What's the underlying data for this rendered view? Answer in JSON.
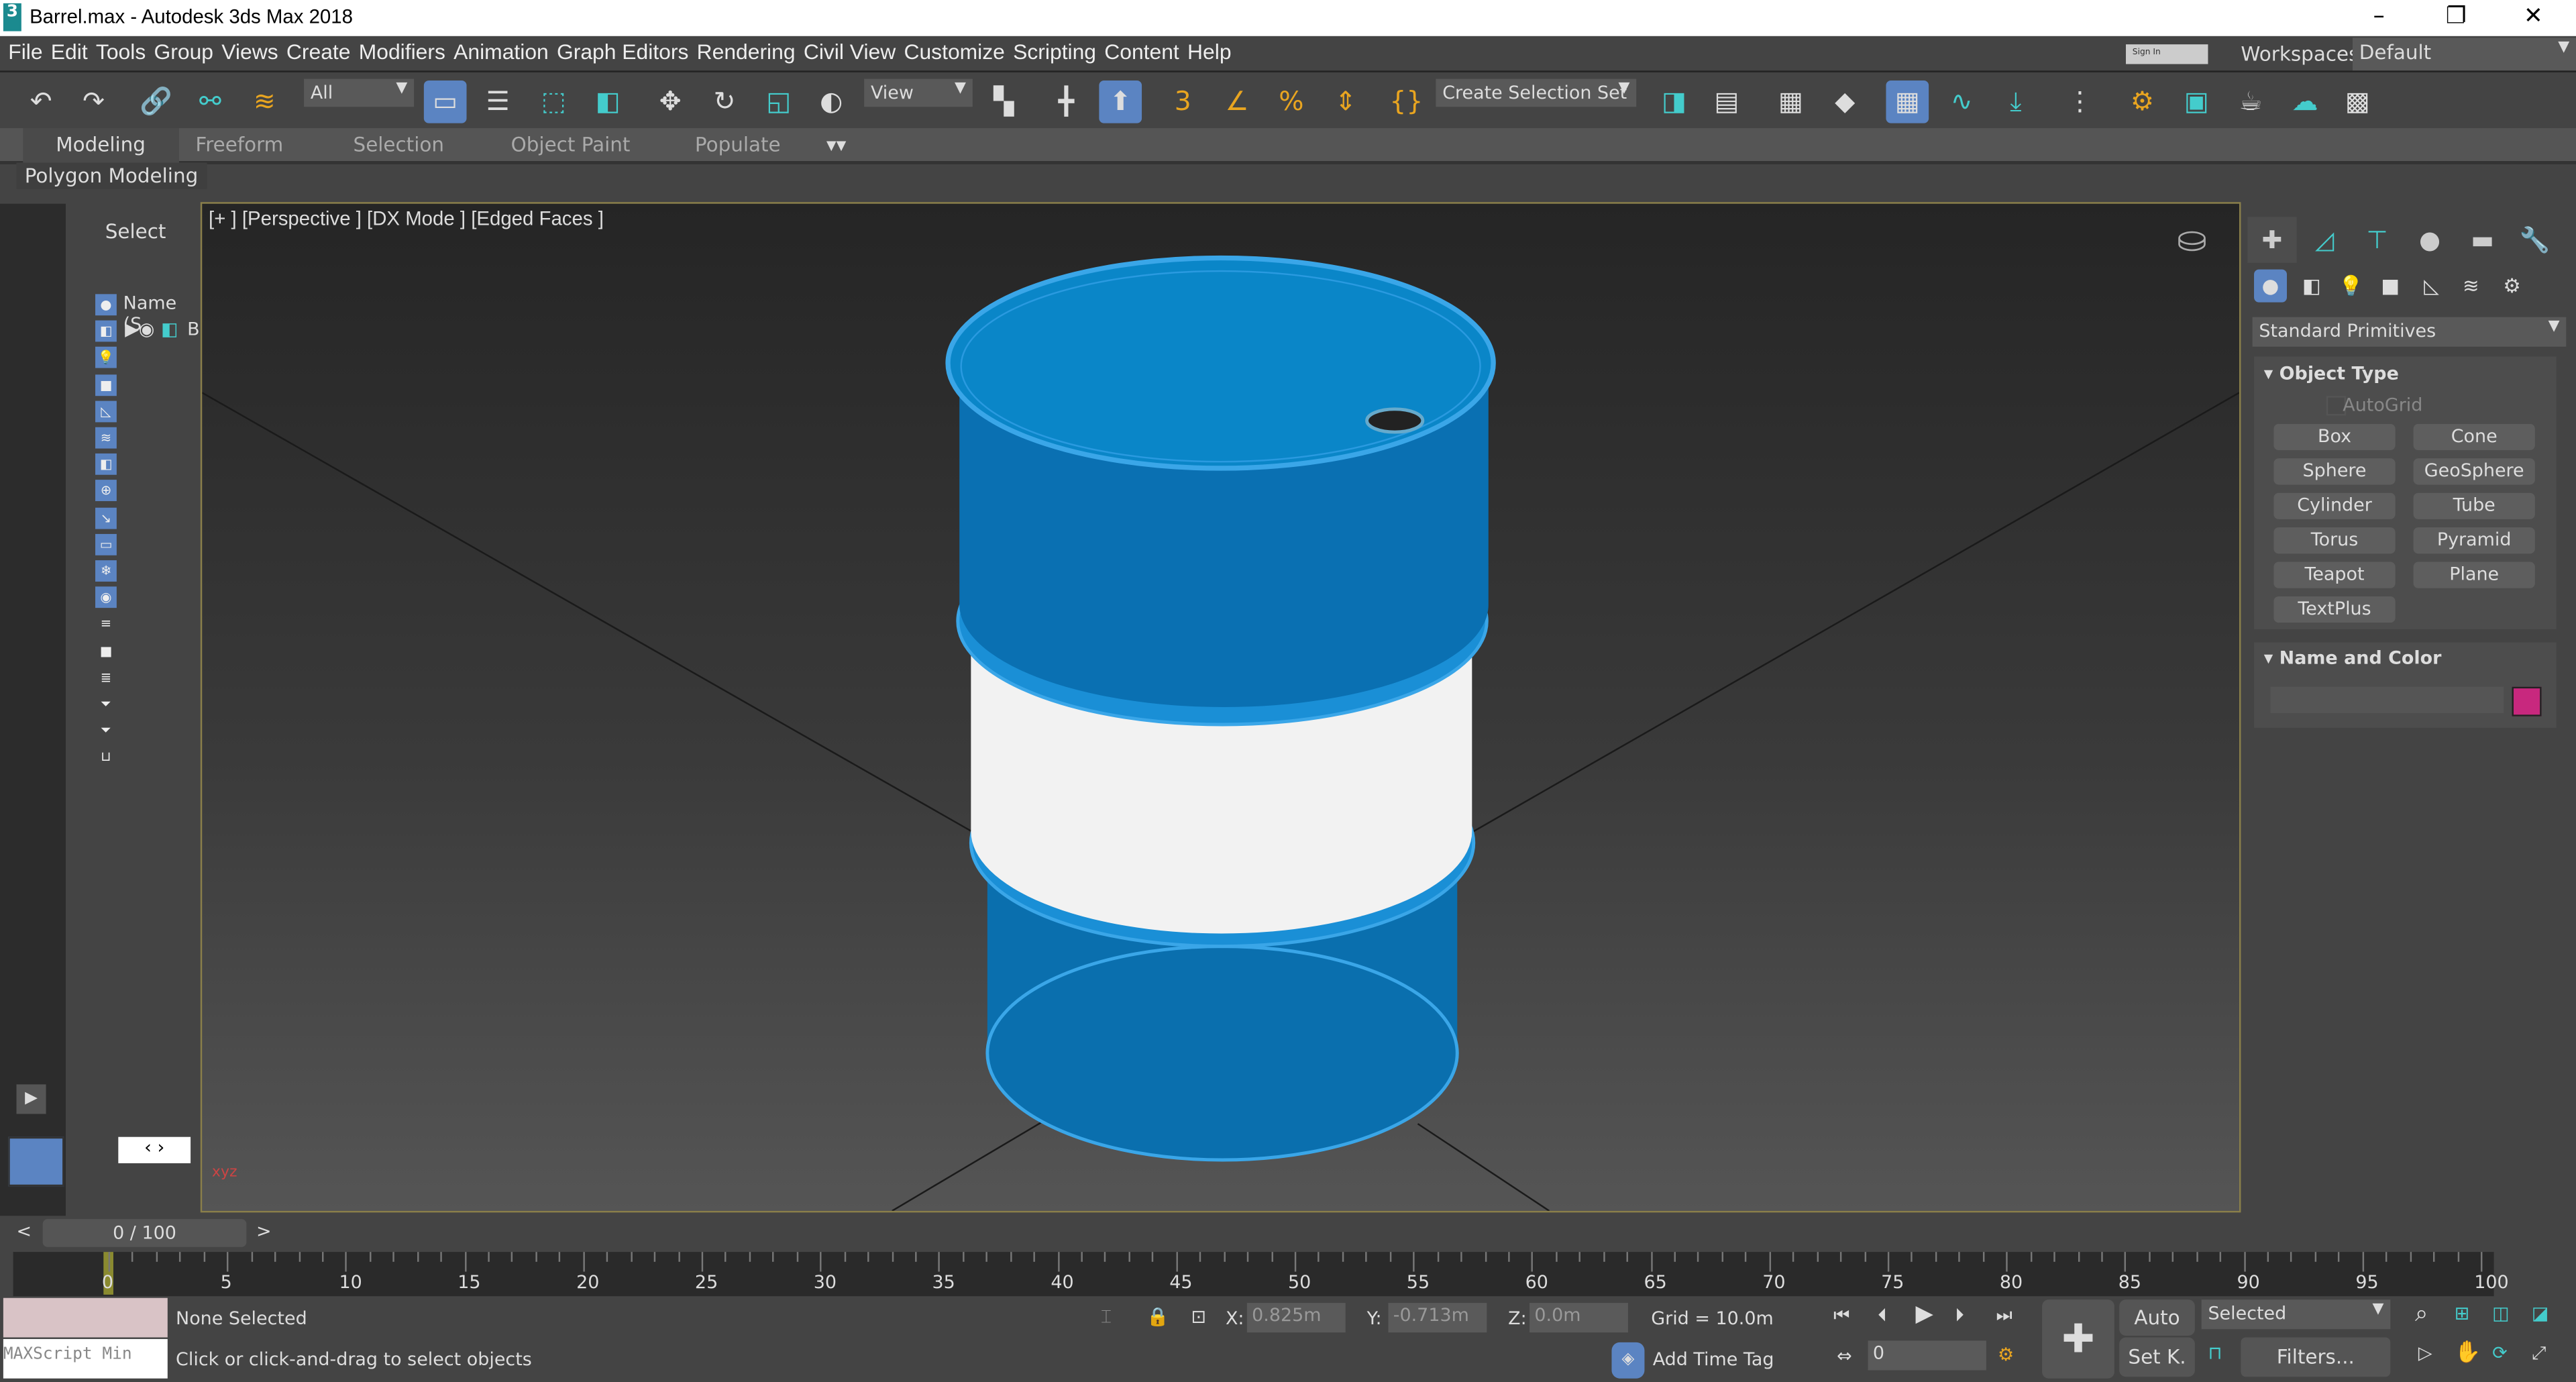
{
  "window": {
    "title": "Barrel.max - Autodesk 3ds Max 2018",
    "controls": [
      "–",
      "❐",
      "✕"
    ]
  },
  "menu": [
    "File",
    "Edit",
    "Tools",
    "Group",
    "Views",
    "Create",
    "Modifiers",
    "Animation",
    "Graph Editors",
    "Rendering",
    "Civil View",
    "Customize",
    "Scripting",
    "Content",
    "Help"
  ],
  "account": {
    "sign_in": "Sign In",
    "workspaces_label": "Workspaces:",
    "workspace": "Default"
  },
  "toolbar": {
    "selection_filter": "All",
    "ref_coord": "View",
    "selection_set": "Create Selection Set",
    "icons": [
      "undo-icon",
      "redo-icon",
      "link-icon",
      "unlink-icon",
      "bind-space-warp-icon",
      "select-object-icon",
      "select-by-name-icon",
      "rect-region-icon",
      "window-crossing-icon",
      "move-icon",
      "rotate-icon",
      "scale-icon",
      "placement-icon",
      "pivot-icon",
      "manipulate-icon",
      "keyboard-shortcut-icon",
      "snap-3d-icon",
      "angle-snap-icon",
      "percent-snap-icon",
      "spinner-snap-icon",
      "edit-named-sets-icon",
      "mirror-icon",
      "align-icon",
      "layer-explorer-icon",
      "toggle-ribbon-icon",
      "scene-explorer-icon",
      "curve-editor-icon",
      "dope-sheet-icon",
      "schematic-view-icon",
      "render-setup-icon",
      "rendered-frame-icon",
      "render-icon",
      "render-cloud-icon",
      "render-gallery-icon"
    ]
  },
  "ribbon": {
    "tabs": [
      "Modeling",
      "Freeform",
      "Selection",
      "Object Paint",
      "Populate"
    ],
    "active": "Modeling",
    "panel": "Polygon Modeling"
  },
  "scene_explorer": {
    "title": "Select",
    "column": "Name (S",
    "row_label": "B"
  },
  "viewport": {
    "label": "[+ ] [Perspective ] [DX Mode ] [Edged Faces ]",
    "barrel_color": "#0a78bd",
    "band_color": "#f0f0f0"
  },
  "command_panel": {
    "category": "Standard Primitives",
    "object_type": {
      "title": "Object Type",
      "autogrid": "AutoGrid",
      "buttons": [
        "Box",
        "Cone",
        "Sphere",
        "GeoSphere",
        "Cylinder",
        "Tube",
        "Torus",
        "Pyramid",
        "Teapot",
        "Plane",
        "TextPlus"
      ]
    },
    "name_color": {
      "title": "Name and Color",
      "name_value": "",
      "color": "#c8287e"
    }
  },
  "timeline": {
    "frame_display": "0 / 100",
    "prev": "<",
    "next": ">",
    "ticks": [
      "0",
      "5",
      "10",
      "15",
      "20",
      "25",
      "30",
      "35",
      "40",
      "45",
      "50",
      "55",
      "60",
      "65",
      "70",
      "75",
      "80",
      "85",
      "90",
      "95",
      "100"
    ]
  },
  "status": {
    "selection": "None Selected",
    "prompt": "Click or click-and-drag to select objects",
    "maxscript": "MAXScript Min",
    "x_label": "X:",
    "x": "0.825m",
    "y_label": "Y:",
    "y": "-0.713m",
    "z_label": "Z:",
    "z": "0.0m",
    "grid": "Grid = 10.0m",
    "add_time_tag": "Add Time Tag",
    "auto": "Auto",
    "set_key": "Set K.",
    "key_filter": "Selected",
    "filters": "Filters...",
    "current_frame": "0"
  }
}
